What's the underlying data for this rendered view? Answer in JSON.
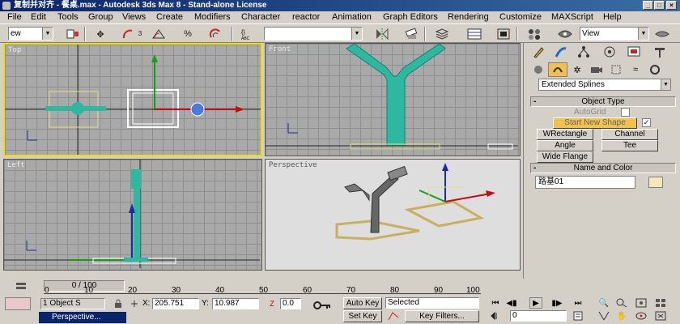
{
  "window": {
    "title": "复制并对齐 - 餐桌.max - Autodesk 3ds Max 8 - Stand-alone License"
  },
  "menu": [
    "File",
    "Edit",
    "Tools",
    "Group",
    "Views",
    "Create",
    "Modifiers",
    "Character",
    "reactor",
    "Animation",
    "Graph Editors",
    "Rendering",
    "Customize",
    "MAXScript",
    "Help"
  ],
  "toolbar": {
    "selection_filter": "ew",
    "named_selection": "",
    "ref_coord": "View",
    "angle_snap_label": "3"
  },
  "viewports": {
    "top": "Top",
    "front": "Front",
    "left": "Left",
    "perspective": "Perspective"
  },
  "command_panel": {
    "category": "Extended Splines",
    "object_type": {
      "title": "Object Type",
      "autogrid": "AutoGrid",
      "start_new_shape": "Start New Shape",
      "buttons": [
        "WRectangle",
        "Channel",
        "Angle",
        "Tee",
        "Wide Flange"
      ]
    },
    "name_and_color": {
      "title": "Name and Color",
      "name": "路基01",
      "color": "#f4e8b8"
    }
  },
  "timeline": {
    "slider": "0 / 100",
    "ticks": [
      "0",
      "10",
      "20",
      "30",
      "40",
      "50",
      "60",
      "70",
      "80",
      "90",
      "100"
    ]
  },
  "status": {
    "selection": "1 Object S",
    "x_label": "X:",
    "x_value": "205.751",
    "y_label": "Y:",
    "y_value": "10.987",
    "z_value": "0.0",
    "auto_key": "Auto Key",
    "set_key": "Set Key",
    "key_mode": "Selected",
    "key_filters": "Key Filters...",
    "frame": "0",
    "taskbar_item": "Perspective..."
  }
}
